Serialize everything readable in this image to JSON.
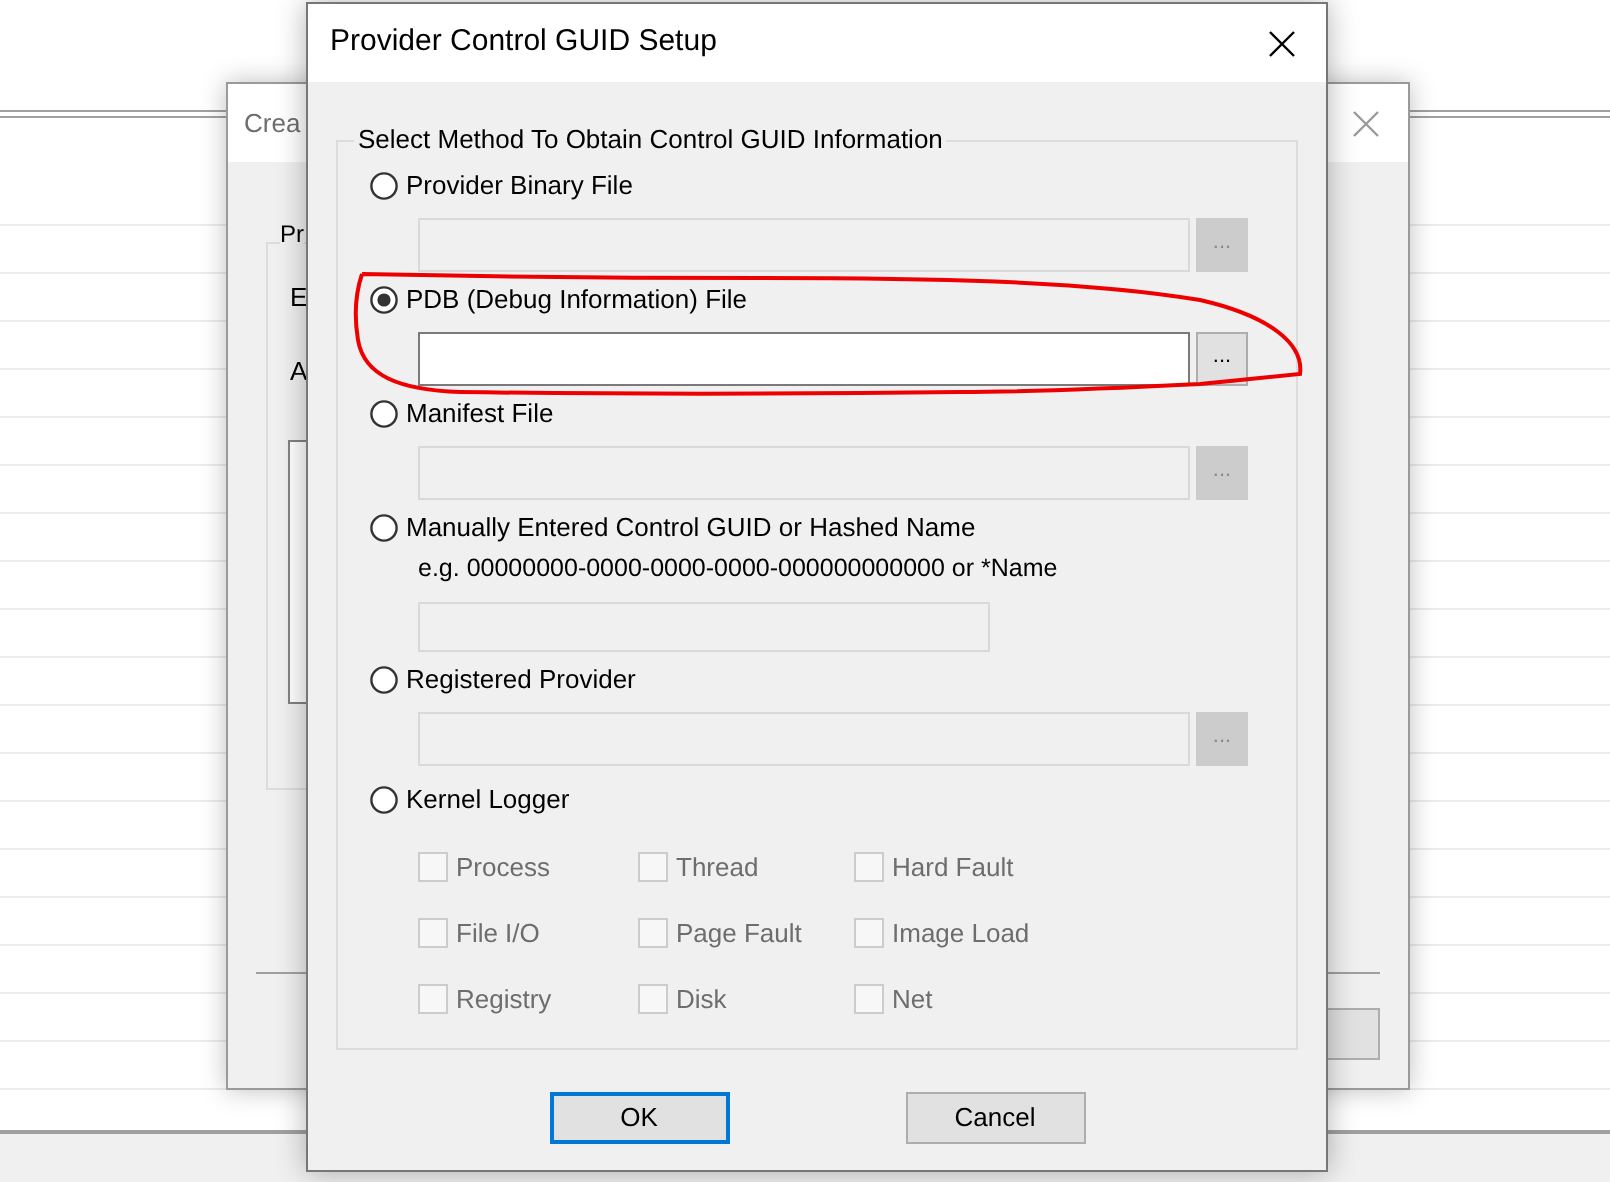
{
  "back_window": {
    "title": "Crea",
    "group_label": "Pr",
    "labels": [
      "E",
      "A"
    ]
  },
  "dialog": {
    "title": "Provider Control GUID Setup",
    "group_label": "Select Method To Obtain Control GUID Information",
    "options": [
      {
        "kind": "file",
        "label": "Provider Binary File",
        "selected": false,
        "field": {
          "disabled": true
        },
        "browse": "..."
      },
      {
        "kind": "file",
        "label": "PDB (Debug Information) File",
        "selected": true,
        "field": {
          "disabled": false
        },
        "browse": "..."
      },
      {
        "kind": "file",
        "label": "Manifest File",
        "selected": false,
        "field": {
          "disabled": true
        },
        "browse": "..."
      },
      {
        "kind": "text",
        "label": "Manually Entered Control GUID or Hashed Name",
        "selected": false,
        "hint": "e.g. 00000000-0000-0000-0000-000000000000 or *Name",
        "field": {
          "disabled": true
        }
      },
      {
        "kind": "file",
        "label": "Registered Provider",
        "selected": false,
        "field": {
          "disabled": true
        },
        "browse": "..."
      },
      {
        "kind": "kernel",
        "label": "Kernel Logger",
        "selected": false,
        "checkboxes": [
          {
            "label": "Process",
            "checked": false,
            "disabled": true
          },
          {
            "label": "Thread",
            "checked": false,
            "disabled": true
          },
          {
            "label": "Hard Fault",
            "checked": false,
            "disabled": true
          },
          {
            "label": "File I/O",
            "checked": false,
            "disabled": true
          },
          {
            "label": "Page Fault",
            "checked": false,
            "disabled": true
          },
          {
            "label": "Image Load",
            "checked": false,
            "disabled": true
          },
          {
            "label": "Registry",
            "checked": false,
            "disabled": true
          },
          {
            "label": "Disk",
            "checked": false,
            "disabled": true
          },
          {
            "label": "Net",
            "checked": false,
            "disabled": true
          }
        ]
      }
    ],
    "buttons": [
      {
        "label": "OK",
        "default": true
      },
      {
        "label": "Cancel",
        "default": false
      }
    ]
  }
}
